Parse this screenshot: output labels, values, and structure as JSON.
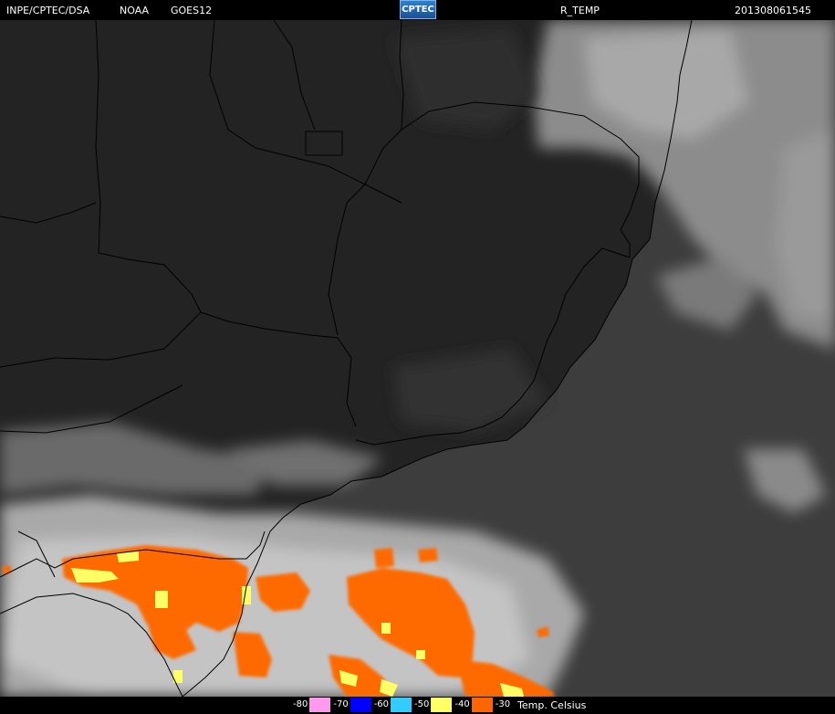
{
  "header": {
    "source": "INPE/CPTEC/DSA",
    "agency": "NOAA",
    "satellite": "GOES12",
    "logo_text": "CPTEC",
    "product": "R_TEMP",
    "timestamp": "201308061545"
  },
  "legend": {
    "items": [
      {
        "label": "-80",
        "color": "#ff99ee"
      },
      {
        "label": "-70",
        "color": "#0000ff"
      },
      {
        "label": "-60",
        "color": "#33ccff"
      },
      {
        "label": "-50",
        "color": "#ffff66"
      },
      {
        "label": "-40",
        "color": "#ff6600"
      },
      {
        "label": "-30",
        "color": "#ff6600"
      }
    ],
    "unit": "Temp. Celsius"
  },
  "colors": {
    "land": "#262626",
    "ocean": "#3c3c3c",
    "cloud": "#bdbdbd",
    "cold_cloud_orange": "#ff6a00",
    "very_cold_yellow": "#ffff66",
    "borders": "#000000"
  }
}
